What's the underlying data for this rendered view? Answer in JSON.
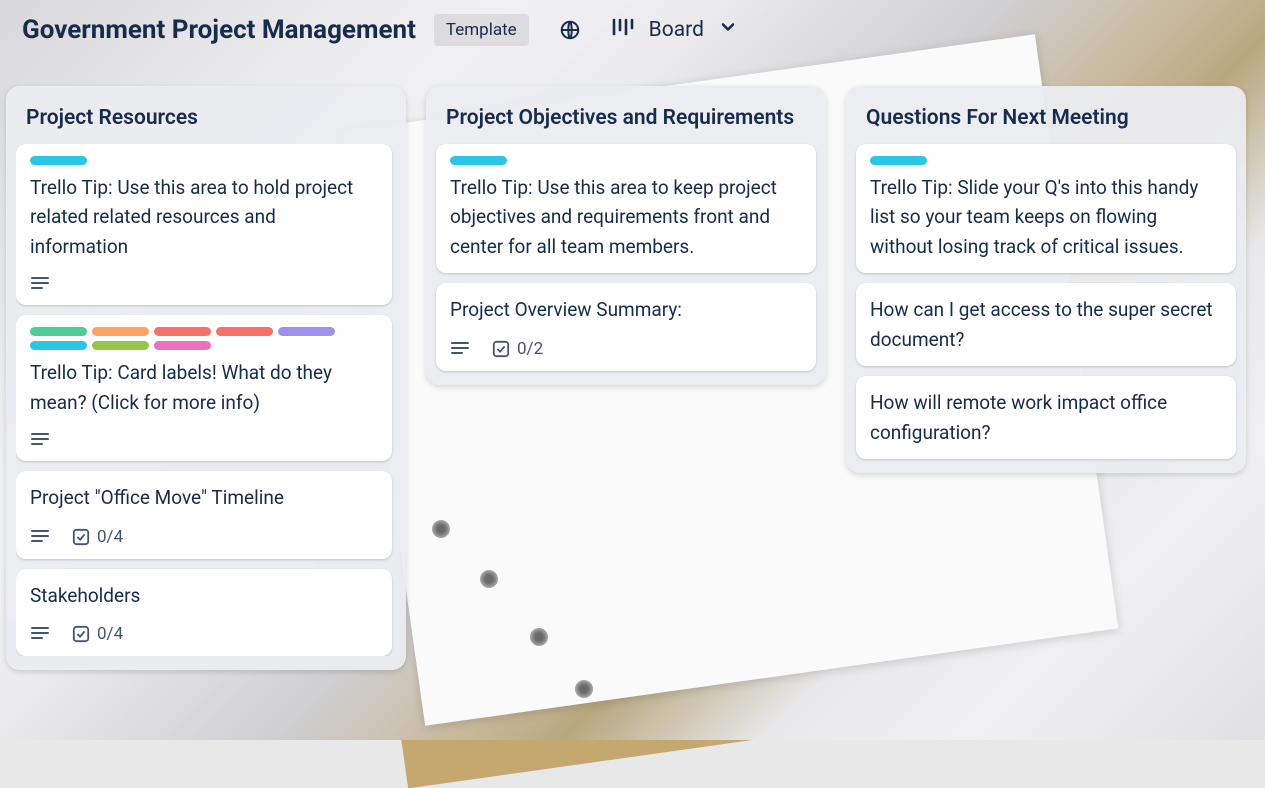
{
  "header": {
    "title": "Government Project Management",
    "template_badge": "Template",
    "view_label": "Board"
  },
  "lists": [
    {
      "title": "Project Resources",
      "cards": [
        {
          "labels": [
            "blue"
          ],
          "text": "Trello Tip: Use this area to hold project related related resources and information",
          "has_description": true
        },
        {
          "labels": [
            "green",
            "orange",
            "red",
            "red2",
            "purple",
            "blue",
            "lime",
            "pink"
          ],
          "text": "Trello Tip: Card labels! What do they mean? (Click for more info)",
          "has_description": true
        },
        {
          "labels": [],
          "text": "Project \"Office Move\" Timeline",
          "has_description": true,
          "checklist": "0/4"
        },
        {
          "labels": [],
          "text": "Stakeholders",
          "has_description": true,
          "checklist": "0/4"
        }
      ]
    },
    {
      "title": "Project Objectives and Requirements",
      "cards": [
        {
          "labels": [
            "blue"
          ],
          "text": "Trello Tip: Use this area to keep project objectives and requirements front and center for all team members."
        },
        {
          "labels": [],
          "text": "Project Overview Summary:",
          "has_description": true,
          "checklist": "0/2"
        }
      ]
    },
    {
      "title": "Questions For Next Meeting",
      "cards": [
        {
          "labels": [
            "blue"
          ],
          "text": "Trello Tip: Slide your Q's into this handy list so your team keeps on flowing without losing track of critical issues."
        },
        {
          "labels": [],
          "text": "How can I get access to the super secret document?"
        },
        {
          "labels": [],
          "text": "How will remote work impact office configuration?"
        }
      ]
    }
  ]
}
